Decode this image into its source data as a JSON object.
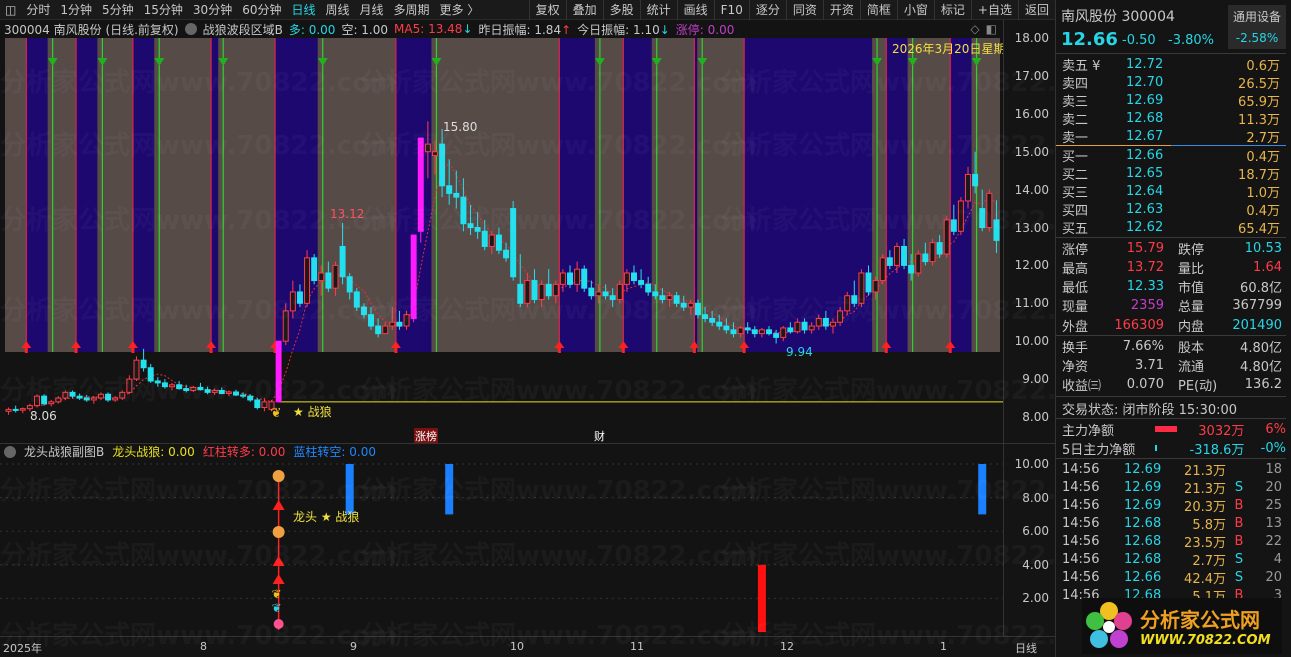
{
  "toolbar": {
    "tabs": [
      "分时",
      "1分钟",
      "5分钟",
      "15分钟",
      "30分钟",
      "60分钟",
      "日线",
      "周线",
      "月线",
      "多周期",
      "更多 〉"
    ],
    "active": "日线",
    "right": [
      "复权",
      "叠加",
      "多股",
      "统计",
      "画线",
      "F10",
      "逐分",
      "同资",
      "开资",
      "简框",
      "小窗",
      "标记",
      "+自选",
      "返回"
    ]
  },
  "indicator": {
    "code_name": "300004 南风股份 (日线.前复权)",
    "name": "战狼波段区域B",
    "duo": "多: 0.00",
    "kong": "空: 1.00",
    "ma5": "MA5: 13.48",
    "ma5_arrow": "↓",
    "zr": "昨日振幅: 1.84",
    "zr_arrow": "↑",
    "jr": "今日振幅: 1.10",
    "jr_arrow": "↓",
    "zt": "涨停: 0.00"
  },
  "annotations": {
    "high": "15.80",
    "mid_high": "13.12",
    "low_left": "8.06",
    "low_right": "9.94",
    "date": "2026年3月20日星期",
    "zhanlang": "★ 战狼",
    "zhangbang": "涨榜",
    "cai": "财",
    "longtou": "龙头 ★ 战狼"
  },
  "subchart": {
    "name": "龙头战狼副图B",
    "a": "龙头战狼: 0.00",
    "b": "红柱转多: 0.00",
    "c": "蓝柱转空: 0.00"
  },
  "yaxis": {
    "main": [
      "18.00",
      "17.00",
      "16.00",
      "15.00",
      "14.00",
      "13.00",
      "12.00",
      "11.00",
      "10.00",
      "9.00",
      "8.00"
    ],
    "sub": [
      "10.00",
      "8.00",
      "6.00",
      "4.00",
      "2.00"
    ]
  },
  "xaxis": {
    "labels": [
      "2025年",
      "8",
      "9",
      "10",
      "11",
      "12",
      "1"
    ],
    "period": "日线"
  },
  "watermark": "分析家公式网www.70822.com",
  "logo": {
    "title": "分析家公式网",
    "url": "WWW.70822.COM"
  },
  "quote": {
    "name": "南风股份 300004",
    "industry": "通用设备",
    "industry_change": "-2.58%",
    "price": "12.66",
    "change": "-0.50",
    "pct": "-3.80%",
    "asks": [
      {
        "l": "卖五 ¥",
        "p": "12.72",
        "v": "0.6万"
      },
      {
        "l": "卖四",
        "p": "12.70",
        "v": "26.5万"
      },
      {
        "l": "卖三",
        "p": "12.69",
        "v": "65.9万"
      },
      {
        "l": "卖二",
        "p": "12.68",
        "v": "11.3万"
      },
      {
        "l": "卖一",
        "p": "12.67",
        "v": "2.7万"
      }
    ],
    "bids": [
      {
        "l": "买一",
        "p": "12.66",
        "v": "0.4万"
      },
      {
        "l": "买二",
        "p": "12.65",
        "v": "18.7万"
      },
      {
        "l": "买三",
        "p": "12.64",
        "v": "1.0万"
      },
      {
        "l": "买四",
        "p": "12.63",
        "v": "0.4万"
      },
      {
        "l": "买五",
        "p": "12.62",
        "v": "65.4万"
      }
    ],
    "stats": [
      [
        "涨停",
        "15.79",
        "跌停",
        "10.53"
      ],
      [
        "最高",
        "13.72",
        "量比",
        "1.64"
      ],
      [
        "最低",
        "12.33",
        "市值",
        "60.8亿"
      ],
      [
        "现量",
        "2359",
        "总量",
        "367799"
      ],
      [
        "外盘",
        "166309",
        "内盘",
        "201490"
      ]
    ],
    "stats2": [
      [
        "换手",
        "7.66%",
        "股本",
        "4.80亿"
      ],
      [
        "净资",
        "3.71",
        "流通",
        "4.80亿"
      ],
      [
        "收益㈢",
        "0.070",
        "PE(动)",
        "136.2"
      ]
    ],
    "status": "交易状态: 闭市阶段 15:30:00",
    "flow": [
      {
        "l": "主力净额",
        "v": "3032万",
        "p": "6%"
      },
      {
        "l": "5日主力净额",
        "v": "-318.6万",
        "p": "-0%"
      }
    ],
    "ticks": [
      [
        "14:56",
        "12.69",
        "21.3万",
        "",
        "18"
      ],
      [
        "14:56",
        "12.69",
        "21.3万",
        "S",
        "20"
      ],
      [
        "14:56",
        "12.69",
        "20.3万",
        "B",
        "25"
      ],
      [
        "14:56",
        "12.68",
        "5.8万",
        "B",
        "13"
      ],
      [
        "14:56",
        "12.68",
        "23.5万",
        "B",
        "22"
      ],
      [
        "14:56",
        "12.68",
        "2.7万",
        "S",
        "4"
      ],
      [
        "14:56",
        "12.66",
        "42.4万",
        "S",
        "20"
      ],
      [
        "14:56",
        "12.68",
        "5.1万",
        "B",
        "3"
      ]
    ]
  },
  "colors": {
    "up": "#ff3b4a",
    "down": "#22e0ee",
    "limit": "#ff1aff",
    "purple_band": "#1d0870",
    "brown_band": "#574b48",
    "ma": "#e0303a"
  },
  "chart_data": {
    "type": "candlestick",
    "ylim": [
      8.0,
      18.0
    ],
    "candles": [
      [
        8.15,
        8.25,
        8.06,
        8.2
      ],
      [
        8.2,
        8.3,
        8.12,
        8.18
      ],
      [
        8.18,
        8.25,
        8.1,
        8.22
      ],
      [
        8.22,
        8.35,
        8.15,
        8.3
      ],
      [
        8.3,
        8.6,
        8.25,
        8.55
      ],
      [
        8.55,
        8.6,
        8.3,
        8.35
      ],
      [
        8.35,
        8.45,
        8.28,
        8.4
      ],
      [
        8.4,
        8.55,
        8.35,
        8.5
      ],
      [
        8.5,
        8.7,
        8.45,
        8.65
      ],
      [
        8.65,
        8.7,
        8.5,
        8.55
      ],
      [
        8.55,
        8.62,
        8.45,
        8.5
      ],
      [
        8.5,
        8.58,
        8.4,
        8.45
      ],
      [
        8.45,
        8.55,
        8.35,
        8.5
      ],
      [
        8.5,
        8.65,
        8.45,
        8.6
      ],
      [
        8.6,
        8.65,
        8.4,
        8.45
      ],
      [
        8.45,
        8.55,
        8.4,
        8.5
      ],
      [
        8.5,
        8.7,
        8.45,
        8.65
      ],
      [
        8.65,
        9.1,
        8.6,
        9.0
      ],
      [
        9.0,
        9.6,
        8.95,
        9.5
      ],
      [
        9.5,
        9.8,
        9.2,
        9.3
      ],
      [
        9.3,
        9.4,
        8.9,
        8.95
      ],
      [
        8.95,
        9.05,
        8.8,
        8.9
      ],
      [
        8.9,
        9.0,
        8.75,
        8.8
      ],
      [
        8.8,
        8.9,
        8.7,
        8.85
      ],
      [
        8.85,
        8.95,
        8.72,
        8.75
      ],
      [
        8.75,
        8.85,
        8.65,
        8.7
      ],
      [
        8.7,
        8.82,
        8.66,
        8.78
      ],
      [
        8.78,
        8.9,
        8.7,
        8.72
      ],
      [
        8.72,
        8.8,
        8.6,
        8.65
      ],
      [
        8.65,
        8.75,
        8.58,
        8.7
      ],
      [
        8.7,
        8.78,
        8.6,
        8.62
      ],
      [
        8.62,
        8.7,
        8.55,
        8.66
      ],
      [
        8.66,
        8.72,
        8.55,
        8.58
      ],
      [
        8.58,
        8.65,
        8.5,
        8.55
      ],
      [
        8.55,
        8.6,
        8.4,
        8.45
      ],
      [
        8.45,
        8.5,
        8.2,
        8.25
      ],
      [
        8.25,
        8.5,
        8.15,
        8.4
      ],
      [
        8.2,
        8.45,
        8.15,
        8.4
      ],
      [
        8.4,
        10.0,
        8.4,
        10.0
      ],
      [
        10.0,
        11.0,
        9.9,
        10.8
      ],
      [
        10.8,
        11.6,
        10.6,
        11.3
      ],
      [
        11.3,
        11.5,
        10.9,
        11.0
      ],
      [
        11.0,
        12.4,
        10.9,
        12.2
      ],
      [
        12.2,
        12.3,
        11.5,
        11.6
      ],
      [
        11.6,
        12.0,
        11.2,
        11.8
      ],
      [
        11.8,
        12.1,
        11.3,
        11.4
      ],
      [
        11.4,
        12.1,
        11.2,
        12.0
      ],
      [
        12.5,
        13.12,
        11.5,
        11.7
      ],
      [
        11.7,
        11.8,
        11.1,
        11.3
      ],
      [
        11.3,
        11.4,
        10.8,
        10.9
      ],
      [
        10.9,
        11.0,
        10.6,
        10.7
      ],
      [
        10.7,
        10.9,
        10.3,
        10.4
      ],
      [
        10.4,
        10.6,
        10.1,
        10.2
      ],
      [
        10.2,
        10.5,
        10.2,
        10.4
      ],
      [
        10.4,
        10.9,
        10.3,
        10.5
      ],
      [
        10.5,
        10.8,
        10.3,
        10.4
      ],
      [
        10.4,
        10.8,
        10.3,
        10.7
      ],
      [
        10.6,
        12.8,
        10.5,
        12.8
      ],
      [
        12.9,
        15.36,
        12.6,
        15.36
      ],
      [
        15.0,
        15.8,
        14.3,
        15.2
      ],
      [
        14.9,
        15.3,
        14.4,
        15.0
      ],
      [
        15.2,
        15.6,
        13.8,
        14.1
      ],
      [
        14.1,
        14.8,
        13.6,
        13.9
      ],
      [
        13.9,
        14.5,
        13.5,
        13.8
      ],
      [
        13.8,
        14.3,
        12.9,
        13.1
      ],
      [
        13.1,
        13.6,
        12.8,
        13.0
      ],
      [
        13.0,
        13.4,
        12.7,
        12.9
      ],
      [
        12.9,
        13.2,
        12.4,
        12.5
      ],
      [
        12.5,
        12.9,
        12.3,
        12.8
      ],
      [
        12.8,
        13.0,
        12.3,
        12.4
      ],
      [
        12.4,
        12.6,
        12.1,
        12.2
      ],
      [
        13.5,
        13.7,
        11.6,
        11.7
      ],
      [
        11.5,
        12.3,
        10.9,
        11.0
      ],
      [
        11.0,
        11.8,
        10.9,
        11.6
      ],
      [
        11.6,
        11.9,
        11.0,
        11.1
      ],
      [
        11.1,
        11.6,
        10.9,
        11.5
      ],
      [
        11.5,
        11.9,
        11.1,
        11.2
      ],
      [
        11.2,
        11.6,
        11.0,
        11.5
      ],
      [
        11.5,
        11.9,
        11.3,
        11.8
      ],
      [
        11.8,
        12.0,
        11.4,
        11.5
      ],
      [
        11.5,
        12.1,
        11.3,
        11.9
      ],
      [
        11.9,
        12.0,
        11.3,
        11.4
      ],
      [
        11.4,
        11.6,
        11.1,
        11.2
      ],
      [
        11.2,
        11.5,
        11.0,
        11.3
      ],
      [
        11.3,
        11.5,
        11.1,
        11.2
      ],
      [
        11.2,
        11.4,
        10.9,
        11.1
      ],
      [
        11.1,
        11.6,
        11.0,
        11.5
      ],
      [
        11.5,
        11.9,
        11.3,
        11.8
      ],
      [
        11.8,
        12.0,
        11.5,
        11.6
      ],
      [
        11.6,
        11.9,
        11.4,
        11.5
      ],
      [
        11.5,
        11.7,
        11.2,
        11.3
      ],
      [
        11.3,
        11.5,
        11.1,
        11.2
      ],
      [
        11.2,
        11.4,
        11.0,
        11.1
      ],
      [
        11.1,
        11.3,
        10.9,
        11.2
      ],
      [
        11.2,
        11.3,
        10.9,
        11.0
      ],
      [
        11.0,
        11.2,
        10.8,
        10.9
      ],
      [
        10.9,
        11.1,
        10.7,
        11.0
      ],
      [
        11.0,
        11.1,
        10.6,
        10.7
      ],
      [
        10.7,
        10.9,
        10.5,
        10.6
      ],
      [
        10.6,
        10.8,
        10.4,
        10.5
      ],
      [
        10.5,
        10.7,
        10.3,
        10.4
      ],
      [
        10.4,
        10.6,
        10.2,
        10.3
      ],
      [
        10.3,
        10.5,
        10.1,
        10.2
      ],
      [
        10.2,
        10.4,
        10.1,
        10.35
      ],
      [
        10.35,
        10.5,
        10.2,
        10.3
      ],
      [
        10.3,
        10.4,
        10.1,
        10.2
      ],
      [
        10.2,
        10.35,
        10.1,
        10.3
      ],
      [
        10.3,
        10.4,
        10.15,
        10.2
      ],
      [
        10.2,
        10.3,
        9.94,
        10.1
      ],
      [
        10.1,
        10.4,
        10.0,
        10.35
      ],
      [
        10.35,
        10.5,
        10.2,
        10.25
      ],
      [
        10.25,
        10.6,
        10.2,
        10.5
      ],
      [
        10.5,
        10.6,
        10.2,
        10.3
      ],
      [
        10.3,
        10.5,
        10.2,
        10.4
      ],
      [
        10.4,
        10.7,
        10.3,
        10.6
      ],
      [
        10.6,
        10.8,
        10.3,
        10.4
      ],
      [
        10.4,
        10.6,
        10.2,
        10.5
      ],
      [
        10.5,
        10.9,
        10.4,
        10.8
      ],
      [
        10.8,
        11.3,
        10.7,
        11.2
      ],
      [
        11.2,
        11.6,
        10.9,
        11.0
      ],
      [
        11.0,
        11.9,
        10.9,
        11.8
      ],
      [
        11.8,
        12.0,
        11.2,
        11.3
      ],
      [
        11.3,
        11.7,
        11.1,
        11.6
      ],
      [
        11.6,
        12.3,
        11.5,
        12.2
      ],
      [
        12.2,
        12.4,
        11.9,
        12.0
      ],
      [
        12.0,
        12.6,
        11.8,
        12.5
      ],
      [
        12.5,
        12.7,
        11.9,
        12.0
      ],
      [
        12.0,
        12.3,
        11.6,
        11.8
      ],
      [
        11.8,
        12.4,
        11.7,
        12.3
      ],
      [
        12.3,
        12.6,
        12.0,
        12.1
      ],
      [
        12.1,
        12.7,
        12.0,
        12.6
      ],
      [
        12.6,
        12.8,
        12.2,
        12.3
      ],
      [
        12.3,
        13.3,
        12.2,
        13.2
      ],
      [
        13.2,
        13.6,
        12.8,
        12.9
      ],
      [
        12.9,
        13.8,
        12.8,
        13.7
      ],
      [
        13.7,
        14.6,
        13.5,
        14.4
      ],
      [
        14.4,
        15.0,
        13.9,
        14.1
      ],
      [
        13.5,
        14.0,
        12.9,
        13.0
      ],
      [
        13.0,
        14.0,
        12.9,
        13.9
      ],
      [
        13.2,
        13.72,
        12.33,
        12.66
      ]
    ],
    "bands": [
      [
        0,
        3,
        "b"
      ],
      [
        3,
        6,
        "p"
      ],
      [
        6,
        10,
        "b"
      ],
      [
        10,
        13,
        "p"
      ],
      [
        13,
        18,
        "b"
      ],
      [
        18,
        21,
        "p"
      ],
      [
        21,
        29,
        "b"
      ],
      [
        29,
        30,
        "p"
      ],
      [
        30,
        38,
        "b"
      ],
      [
        38,
        44,
        "p"
      ],
      [
        44,
        55,
        "b"
      ],
      [
        55,
        60,
        "p"
      ],
      [
        60,
        78,
        "b"
      ],
      [
        78,
        83,
        "p"
      ],
      [
        83,
        87,
        "b"
      ],
      [
        87,
        91,
        "p"
      ],
      [
        91,
        97,
        "b"
      ],
      [
        97,
        97.4,
        "p"
      ],
      [
        97.4,
        104,
        "b"
      ],
      [
        104,
        122,
        "p"
      ],
      [
        122,
        124,
        "b"
      ],
      [
        124,
        127,
        "p"
      ],
      [
        127,
        133,
        "b"
      ],
      [
        133,
        136,
        "p"
      ],
      [
        136,
        140,
        "b"
      ]
    ],
    "support_level": 8.4,
    "support_from": 38,
    "sub_bars": [
      {
        "i": 48,
        "from": 7,
        "to": 10,
        "color": "blue"
      },
      {
        "i": 62,
        "from": 7,
        "to": 10,
        "color": "blue"
      },
      {
        "i": 106,
        "from": 0,
        "to": 4,
        "color": "red"
      },
      {
        "i": 137,
        "from": 7,
        "to": 10,
        "color": "blue"
      }
    ],
    "sub_ylim": [
      0,
      10
    ]
  }
}
